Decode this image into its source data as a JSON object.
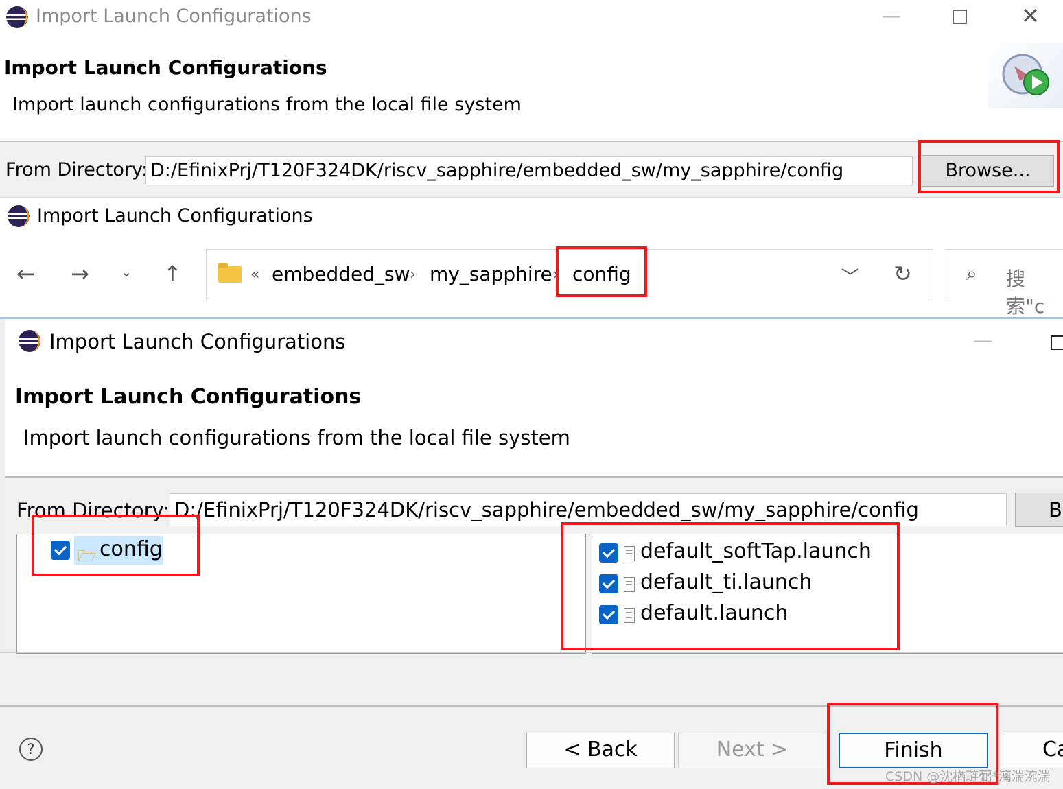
{
  "panel1": {
    "window_title": "Import Launch Configurations",
    "header_title": "Import Launch Configurations",
    "header_desc": "Import launch configurations from the local file system",
    "from_dir_label": "From Directory:",
    "from_dir_value": "D:/EfinixPrj/T120F324DK/riscv_sapphire/embedded_sw/my_sapphire/config",
    "browse_label": "Browse..."
  },
  "panel2": {
    "window_title": "Import Launch Configurations",
    "breadcrumb_more": "«",
    "crumbs": [
      "embedded_sw",
      "my_sapphire",
      "config"
    ],
    "search_placeholder": "搜索\"c"
  },
  "panel3": {
    "window_title": "Import Launch Configurations",
    "header_title": "Import Launch Configurations",
    "header_desc": "Import launch configurations from the local file system",
    "from_dir_label": "From Directory:",
    "from_dir_value": "D:/EfinixPrj/T120F324DK/riscv_sapphire/embedded_sw/my_sapphire/config",
    "browse_partial": "Br",
    "tree_folder": "config",
    "files": [
      "default_softTap.launch",
      "default_ti.launch",
      "default.launch"
    ],
    "buttons": {
      "help": "?",
      "back": "< Back",
      "next": "Next >",
      "finish": "Finish",
      "cancel_partial": "Ca"
    }
  },
  "watermark": "CSDN @沈楢琏弼*漓湍涴湍",
  "colors": {
    "highlight_red": "#f0191e",
    "checkbox_blue": "#0a64c8",
    "selection_blue": "#cce8ff"
  }
}
